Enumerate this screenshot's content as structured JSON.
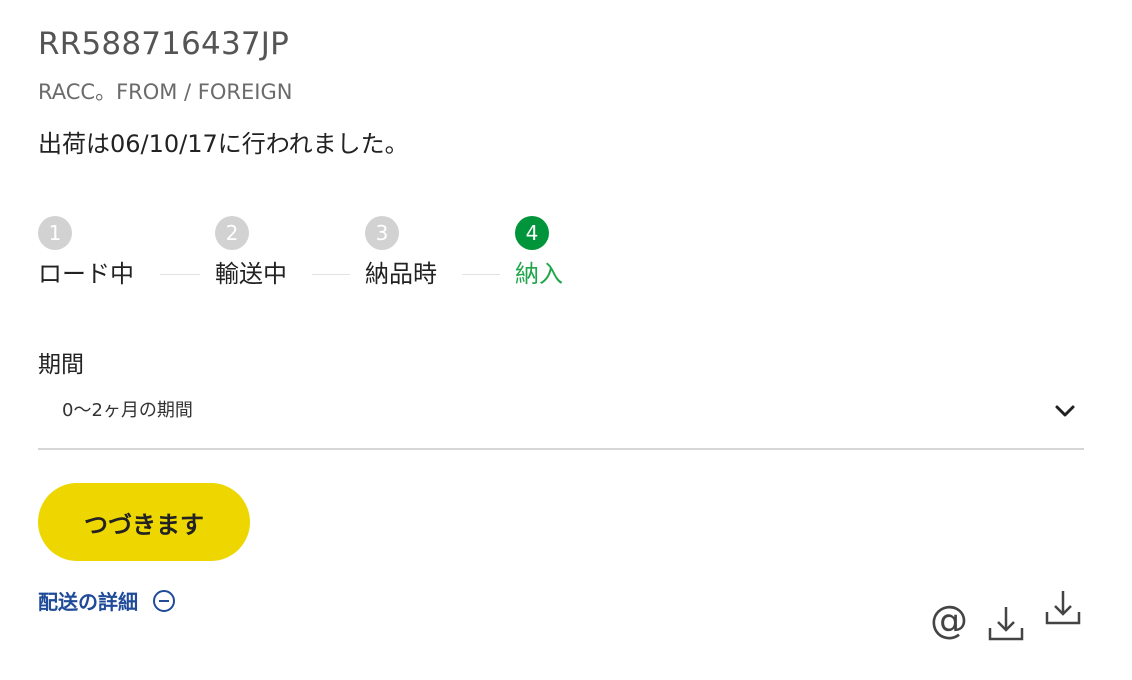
{
  "shipment": {
    "tracking_number": "RR588716437JP",
    "service_type": "RACC。FROM / FOREIGN",
    "status_message": "出荷は06/10/17に行われました。"
  },
  "steps": [
    {
      "number": "1",
      "label": "ロード中",
      "active": false
    },
    {
      "number": "2",
      "label": "輸送中",
      "active": false
    },
    {
      "number": "3",
      "label": "納品時",
      "active": false
    },
    {
      "number": "4",
      "label": "納入",
      "active": true
    }
  ],
  "period": {
    "label": "期間",
    "selected": "0〜2ヶ月の期間"
  },
  "actions": {
    "continue_label": "つづきます",
    "details_label": "配送の詳細",
    "email_icon": "@"
  },
  "icons": {
    "expand": "chevron-down-icon",
    "collapse": "minus-circle-icon",
    "email": "at-icon",
    "download": "download-icon"
  },
  "colors": {
    "active_step": "#00953a",
    "active_label": "#1fa64a",
    "inactive_step": "#d2d2d2",
    "button": "#eed600",
    "link": "#1f4b99"
  }
}
